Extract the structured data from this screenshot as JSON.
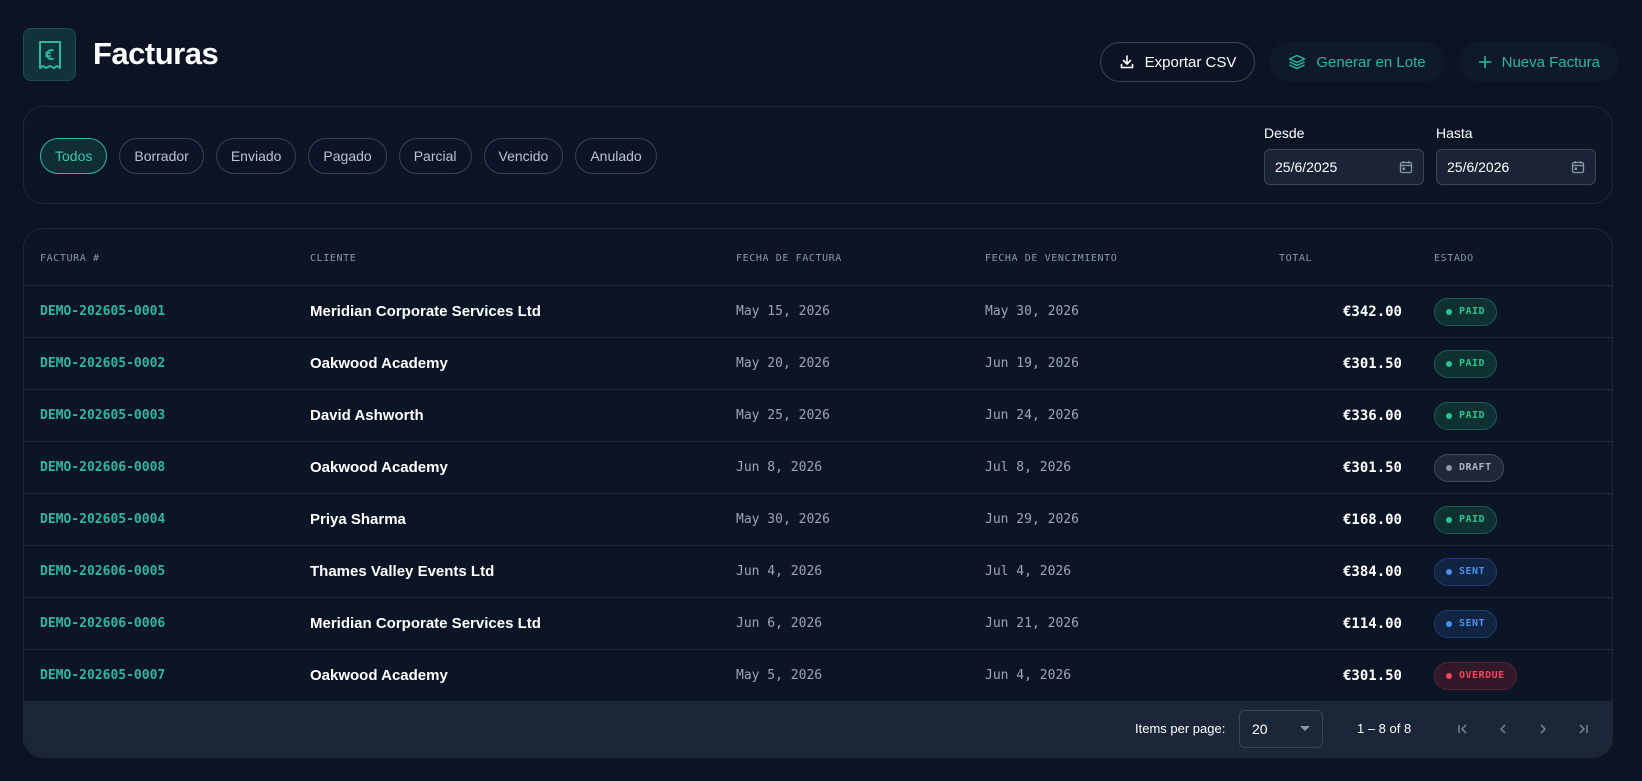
{
  "header": {
    "title": "Facturas",
    "actions": {
      "export_label": "Exportar CSV",
      "batch_label": "Generar en Lote",
      "new_label": "Nueva Factura"
    }
  },
  "filters": {
    "chips": [
      "Todos",
      "Borrador",
      "Enviado",
      "Pagado",
      "Parcial",
      "Vencido",
      "Anulado"
    ],
    "active": "Todos",
    "from_label": "Desde",
    "from_value": "25/6/2025",
    "to_label": "Hasta",
    "to_value": "25/6/2026"
  },
  "table": {
    "columns": {
      "invoice": "FACTURA #",
      "client": "CLIENTE",
      "invoice_date": "FECHA DE FACTURA",
      "due_date": "FECHA DE VENCIMIENTO",
      "total": "TOTAL",
      "status": "ESTADO"
    },
    "rows": [
      {
        "invoice": "DEMO-202605-0001",
        "client": "Meridian Corporate Services Ltd",
        "invoice_date": "May 15, 2026",
        "due_date": "May 30, 2026",
        "total": "€342.00",
        "status": "PAID"
      },
      {
        "invoice": "DEMO-202605-0002",
        "client": "Oakwood Academy",
        "invoice_date": "May 20, 2026",
        "due_date": "Jun 19, 2026",
        "total": "€301.50",
        "status": "PAID"
      },
      {
        "invoice": "DEMO-202605-0003",
        "client": "David Ashworth",
        "invoice_date": "May 25, 2026",
        "due_date": "Jun 24, 2026",
        "total": "€336.00",
        "status": "PAID"
      },
      {
        "invoice": "DEMO-202606-0008",
        "client": "Oakwood Academy",
        "invoice_date": "Jun 8, 2026",
        "due_date": "Jul 8, 2026",
        "total": "€301.50",
        "status": "DRAFT"
      },
      {
        "invoice": "DEMO-202605-0004",
        "client": "Priya Sharma",
        "invoice_date": "May 30, 2026",
        "due_date": "Jun 29, 2026",
        "total": "€168.00",
        "status": "PAID"
      },
      {
        "invoice": "DEMO-202606-0005",
        "client": "Thames Valley Events Ltd",
        "invoice_date": "Jun 4, 2026",
        "due_date": "Jul 4, 2026",
        "total": "€384.00",
        "status": "SENT"
      },
      {
        "invoice": "DEMO-202606-0006",
        "client": "Meridian Corporate Services Ltd",
        "invoice_date": "Jun 6, 2026",
        "due_date": "Jun 21, 2026",
        "total": "€114.00",
        "status": "SENT"
      },
      {
        "invoice": "DEMO-202605-0007",
        "client": "Oakwood Academy",
        "invoice_date": "May 5, 2026",
        "due_date": "Jun 4, 2026",
        "total": "€301.50",
        "status": "OVERDUE"
      }
    ]
  },
  "paginator": {
    "items_per_page_label": "Items per page:",
    "items_per_page": "20",
    "range": "1 – 8 of 8"
  },
  "colors": {
    "accent": "#2fb5a0",
    "background": "#0b1324",
    "paid": "#2fc48c",
    "sent": "#4c8ff0",
    "overdue": "#f0475d",
    "draft": "#aab4c2"
  },
  "icons": {
    "logo": "euro-receipt-icon",
    "export": "download-icon",
    "batch": "layers-icon",
    "new": "plus-icon",
    "date": "calendar-icon",
    "select": "caret-down-icon",
    "pager": [
      "first-page-icon",
      "prev-page-icon",
      "next-page-icon",
      "last-page-icon"
    ]
  }
}
